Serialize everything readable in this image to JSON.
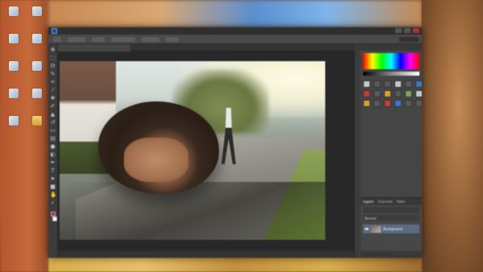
{
  "desktop": {
    "icons": [
      {
        "label": "",
        "type": "app"
      },
      {
        "label": "",
        "type": "app"
      },
      {
        "label": "",
        "type": "app"
      },
      {
        "label": "",
        "type": "app"
      },
      {
        "label": "",
        "type": "app"
      },
      {
        "label": "",
        "type": "app"
      },
      {
        "label": "",
        "type": "app"
      },
      {
        "label": "",
        "type": "app"
      },
      {
        "label": "",
        "type": "app"
      },
      {
        "label": "",
        "type": "folder"
      },
      {
        "label": "",
        "type": "app"
      },
      {
        "label": "",
        "type": "app"
      },
      {
        "label": "",
        "type": "app"
      },
      {
        "label": "",
        "type": "folder"
      },
      {
        "label": "",
        "type": "app"
      },
      {
        "label": "",
        "type": "app"
      }
    ]
  },
  "ps": {
    "menus": [
      "",
      "",
      "",
      "",
      "",
      "",
      "",
      "",
      "",
      ""
    ],
    "doc_tab": "",
    "panel_tabs": [
      "",
      ""
    ],
    "layers": {
      "tabs": [
        "Layers",
        "Channels",
        "Paths"
      ],
      "kind_label": "",
      "blend_mode": "Normal",
      "layer_name": "Background"
    },
    "status": ""
  },
  "colors": {
    "ps_dark": "#3a3a3a",
    "accent_blue": "#3b78c7"
  }
}
